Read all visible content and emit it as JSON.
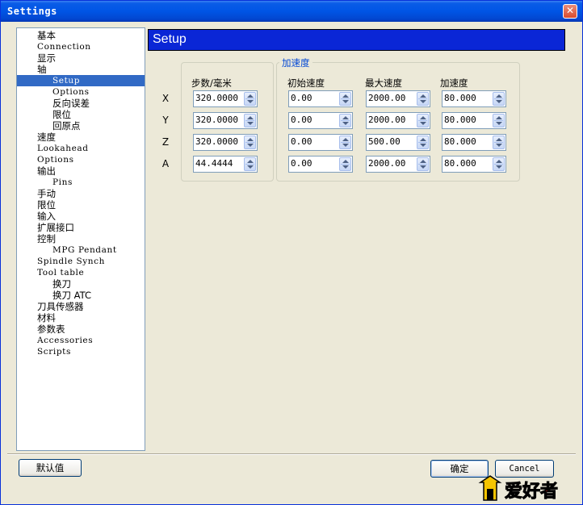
{
  "window": {
    "title": "Settings",
    "close_glyph": "✕"
  },
  "tree": {
    "items": [
      {
        "label": "基本",
        "indent": 0
      },
      {
        "label": "Connection",
        "indent": 0
      },
      {
        "label": "显示",
        "indent": 0
      },
      {
        "label": "轴",
        "indent": 0
      },
      {
        "label": "Setup",
        "indent": 1,
        "selected": true
      },
      {
        "label": "Options",
        "indent": 1
      },
      {
        "label": "反向误差",
        "indent": 1
      },
      {
        "label": "限位",
        "indent": 1
      },
      {
        "label": "回原点",
        "indent": 1
      },
      {
        "label": "速度",
        "indent": 0
      },
      {
        "label": "Lookahead",
        "indent": 0
      },
      {
        "label": "Options",
        "indent": 0
      },
      {
        "label": "输出",
        "indent": 0
      },
      {
        "label": "Pins",
        "indent": 1
      },
      {
        "label": "手动",
        "indent": 0
      },
      {
        "label": "限位",
        "indent": 0
      },
      {
        "label": "输入",
        "indent": 0
      },
      {
        "label": "扩展接口",
        "indent": 0
      },
      {
        "label": "控制",
        "indent": 0
      },
      {
        "label": "MPG Pendant",
        "indent": 1
      },
      {
        "label": "Spindle Synch",
        "indent": 0
      },
      {
        "label": "Tool table",
        "indent": 0
      },
      {
        "label": "换刀",
        "indent": 1
      },
      {
        "label": "换刀 ATC",
        "indent": 1
      },
      {
        "label": "刀具传感器",
        "indent": 0
      },
      {
        "label": "材料",
        "indent": 0
      },
      {
        "label": "参数表",
        "indent": 0
      },
      {
        "label": "Accessories",
        "indent": 0
      },
      {
        "label": "Scripts",
        "indent": 0
      }
    ]
  },
  "panel": {
    "title": "Setup",
    "group_title": "加速度",
    "columns": [
      "步数/毫米",
      "初始速度",
      "最大速度",
      "加速度"
    ],
    "rows": [
      {
        "axis": "X",
        "values": [
          "320.0000",
          "0.00",
          "2000.00",
          "80.000"
        ]
      },
      {
        "axis": "Y",
        "values": [
          "320.0000",
          "0.00",
          "2000.00",
          "80.000"
        ]
      },
      {
        "axis": "Z",
        "values": [
          "320.0000",
          "0.00",
          "500.00",
          "80.000"
        ]
      },
      {
        "axis": "A",
        "values": [
          "44.4444",
          "0.00",
          "2000.00",
          "80.000"
        ]
      }
    ]
  },
  "buttons": {
    "defaults": "默认值",
    "ok": "确定",
    "cancel": "Cancel"
  },
  "watermark": {
    "text": "爱好者",
    "colors": {
      "text": "#E02010",
      "accent": "#F5C400"
    }
  }
}
